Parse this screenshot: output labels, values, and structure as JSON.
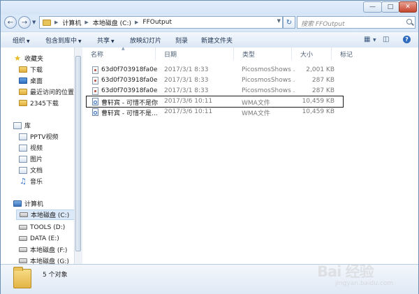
{
  "address": {
    "segments": [
      "计算机",
      "本地磁盘 (C:)",
      "FFOutput"
    ]
  },
  "search": {
    "placeholder": "搜索 FFOutput"
  },
  "toolbar": {
    "organize": "组织",
    "include_in_library": "包含到库中",
    "share": "共享",
    "slideshow": "放映幻灯片",
    "burn": "刻录",
    "new_folder": "新建文件夹"
  },
  "nav": {
    "favorites": "收藏夹",
    "favorites_items": [
      "下载",
      "桌面",
      "最近访问的位置",
      "2345下载"
    ],
    "libraries": "库",
    "libraries_items": [
      "PPTV视频",
      "视频",
      "图片",
      "文档",
      "音乐"
    ],
    "computer": "计算机",
    "drives": [
      "本地磁盘 (C:)",
      "TOOLS (D:)",
      "DATA (E:)",
      "本地磁盘 (F:)",
      "本地磁盘 (G:)"
    ]
  },
  "columns": {
    "name": "名称",
    "date": "日期",
    "type": "类型",
    "size": "大小",
    "tags": "标记"
  },
  "files": [
    {
      "name": "63d0f703918fa0e...",
      "date": "2017/3/1 8:33",
      "type": "PicosmosShows ...",
      "size": "2,001 KB",
      "icon": "doc-icon"
    },
    {
      "name": "63d0f703918fa0e...",
      "date": "2017/3/1 8:33",
      "type": "PicosmosShows ...",
      "size": "287 KB",
      "icon": "doc-icon"
    },
    {
      "name": "63d0f703918fa0e...",
      "date": "2017/3/1 8:33",
      "type": "PicosmosShows ...",
      "size": "287 KB",
      "icon": "doc-icon"
    },
    {
      "name": "曹轩宾 - 可惜不是你",
      "date": "2017/3/6 10:11",
      "type": "WMA文件",
      "size": "10,459 KB",
      "icon": "wma-icon",
      "highlighted": true
    },
    {
      "name": "曹轩宾 - 可惜不是...",
      "date": "2017/3/6 10:11",
      "type": "WMA文件",
      "size": "10,459 KB",
      "icon": "wma-icon"
    }
  ],
  "details": {
    "count": "5 个对象"
  },
  "watermark": {
    "main": "Bai 经验",
    "sub": "jingyan.baidu.com"
  }
}
